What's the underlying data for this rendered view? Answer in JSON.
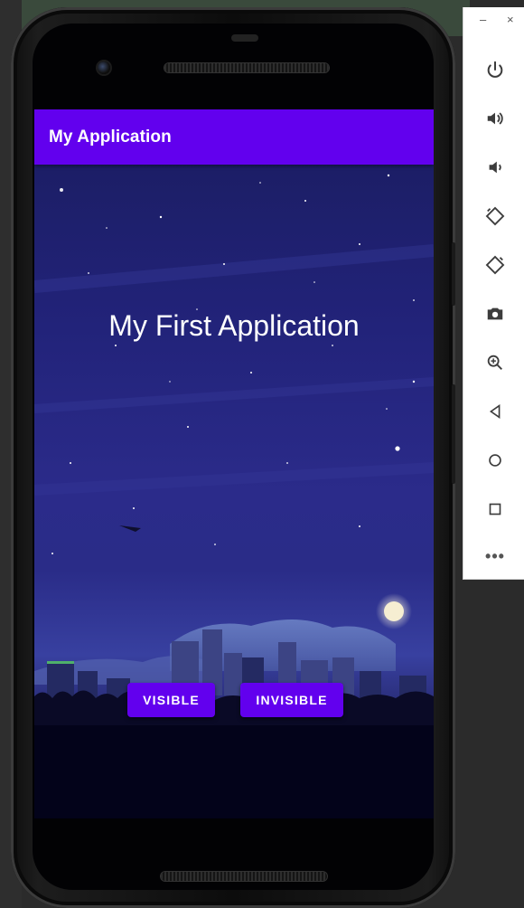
{
  "app": {
    "title": "My Application",
    "headline": "My First Application",
    "accent_color": "#6200ee"
  },
  "buttons": {
    "visible_label": "VISIBLE",
    "invisible_label": "INVISIBLE"
  },
  "window": {
    "minimize_label": "–",
    "close_label": "×"
  },
  "toolbar": {
    "items": [
      {
        "name": "power-icon"
      },
      {
        "name": "volume-up-icon"
      },
      {
        "name": "volume-down-icon"
      },
      {
        "name": "rotate-left-icon"
      },
      {
        "name": "rotate-right-icon"
      },
      {
        "name": "camera-icon"
      },
      {
        "name": "zoom-icon"
      },
      {
        "name": "back-icon"
      },
      {
        "name": "home-icon"
      },
      {
        "name": "overview-icon"
      },
      {
        "name": "more-icon"
      }
    ],
    "more_label": "•••"
  }
}
